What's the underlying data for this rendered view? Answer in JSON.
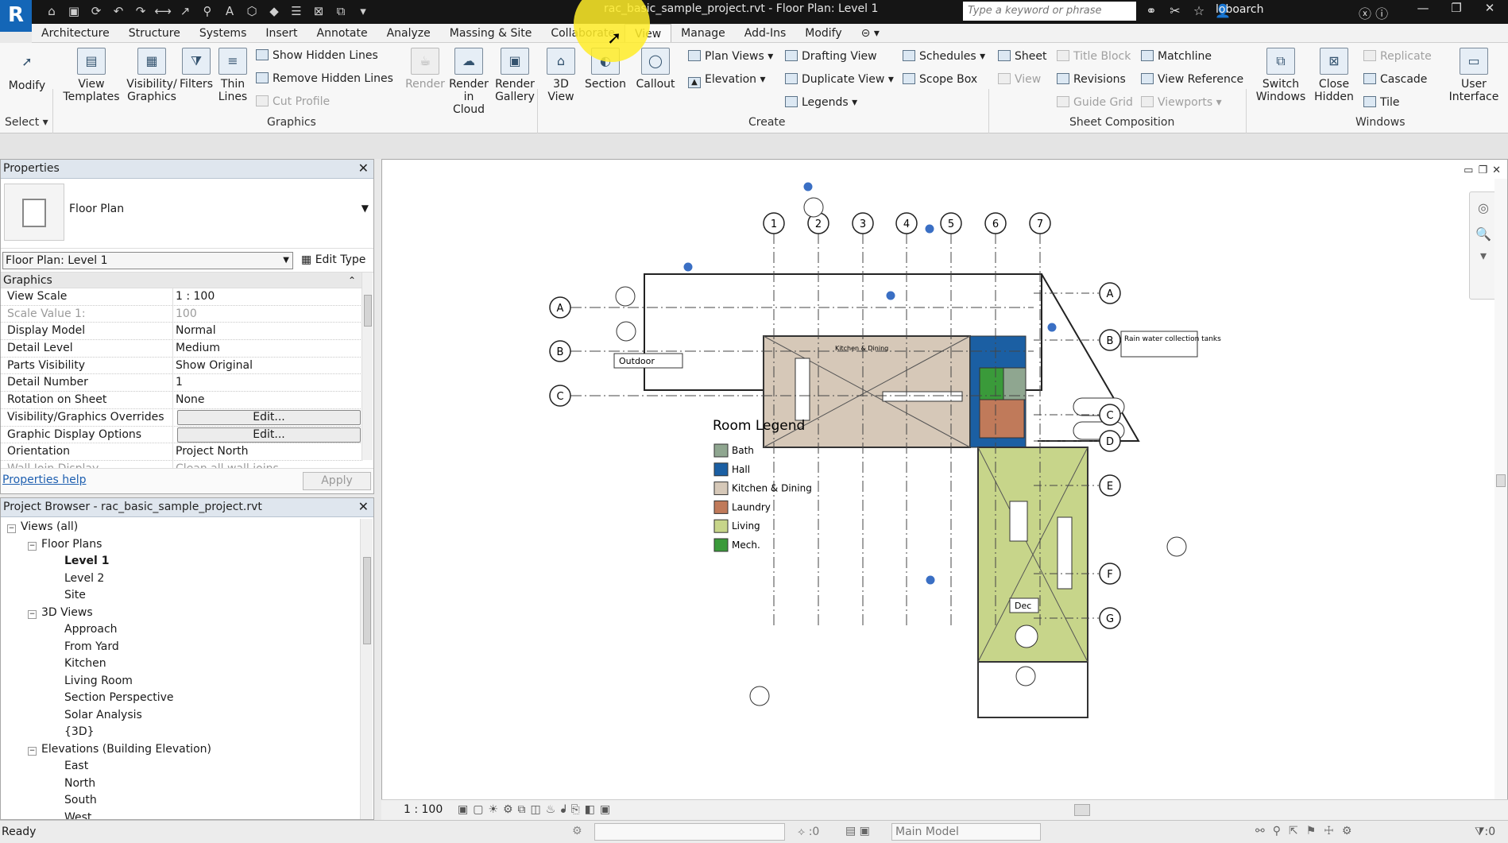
{
  "app": {
    "logo": "R",
    "title": "rac_basic_sample_project.rvt - Floor Plan: Level 1",
    "search_placeholder": "Type a keyword or phrase",
    "user": "loboarch",
    "accent": "#1466b7"
  },
  "menu": {
    "tabs": [
      "Architecture",
      "Structure",
      "Systems",
      "Insert",
      "Annotate",
      "Analyze",
      "Massing & Site",
      "Collaborate",
      "View",
      "Manage",
      "Add-Ins",
      "Modify"
    ],
    "active": "View"
  },
  "ribbon": {
    "select": {
      "modify": "Modify",
      "select_label": "Select"
    },
    "graphics": {
      "view_templates": "View Templates",
      "visibility": "Visibility/ Graphics",
      "filters": "Filters",
      "thin_lines": "Thin Lines",
      "show_hidden": "Show Hidden Lines",
      "remove_hidden": "Remove Hidden Lines",
      "cut_profile": "Cut Profile",
      "render": "Render",
      "render_cloud": "Render in Cloud",
      "render_gallery": "Render Gallery",
      "panel": "Graphics"
    },
    "create": {
      "view3d": "3D View",
      "section": "Section",
      "callout": "Callout",
      "plan_views": "Plan Views",
      "elevation": "Elevation",
      "drafting": "Drafting View",
      "duplicate": "Duplicate View",
      "legends": "Legends",
      "schedules": "Schedules",
      "scope_box": "Scope Box",
      "panel": "Create"
    },
    "sheet": {
      "sheet": "Sheet",
      "view": "View",
      "title_block": "Title Block",
      "revisions": "Revisions",
      "guide_grid": "Guide Grid",
      "matchline": "Matchline",
      "view_reference": "View Reference",
      "viewports": "Viewports",
      "panel": "Sheet Composition"
    },
    "windows": {
      "switch": "Switch Windows",
      "close_hidden": "Close Hidden",
      "replicate": "Replicate",
      "cascade": "Cascade",
      "tile": "Tile",
      "user_interface": "User Interface",
      "panel": "Windows"
    }
  },
  "properties": {
    "title": "Properties",
    "type_name": "Floor Plan",
    "instance": "Floor Plan: Level 1",
    "edit_type": "Edit Type",
    "group": "Graphics",
    "rows": [
      {
        "k": "View Scale",
        "v": "1 : 100",
        "dim": false,
        "btn": false
      },
      {
        "k": "Scale Value    1:",
        "v": "100",
        "dim": true,
        "btn": false
      },
      {
        "k": "Display Model",
        "v": "Normal",
        "dim": false,
        "btn": false
      },
      {
        "k": "Detail Level",
        "v": "Medium",
        "dim": false,
        "btn": false
      },
      {
        "k": "Parts Visibility",
        "v": "Show Original",
        "dim": false,
        "btn": false
      },
      {
        "k": "Detail Number",
        "v": "1",
        "dim": false,
        "btn": false
      },
      {
        "k": "Rotation on Sheet",
        "v": "None",
        "dim": false,
        "btn": false
      },
      {
        "k": "Visibility/Graphics Overrides",
        "v": "Edit...",
        "dim": false,
        "btn": true
      },
      {
        "k": "Graphic Display Options",
        "v": "Edit...",
        "dim": false,
        "btn": true
      },
      {
        "k": "Orientation",
        "v": "Project North",
        "dim": false,
        "btn": false
      },
      {
        "k": "Wall Join Display",
        "v": "Clean all wall joins",
        "dim": true,
        "btn": false
      }
    ],
    "help": "Properties help",
    "apply": "Apply"
  },
  "browser": {
    "title": "Project Browser - rac_basic_sample_project.rvt",
    "nodes": [
      {
        "label": "Views (all)",
        "level": 0,
        "tog": "−",
        "bold": false
      },
      {
        "label": "Floor Plans",
        "level": 1,
        "tog": "−",
        "bold": false
      },
      {
        "label": "Level 1",
        "level": 2,
        "tog": "",
        "bold": true
      },
      {
        "label": "Level 2",
        "level": 2,
        "tog": "",
        "bold": false
      },
      {
        "label": "Site",
        "level": 2,
        "tog": "",
        "bold": false
      },
      {
        "label": "3D Views",
        "level": 1,
        "tog": "−",
        "bold": false
      },
      {
        "label": "Approach",
        "level": 2,
        "tog": "",
        "bold": false
      },
      {
        "label": "From Yard",
        "level": 2,
        "tog": "",
        "bold": false
      },
      {
        "label": "Kitchen",
        "level": 2,
        "tog": "",
        "bold": false
      },
      {
        "label": "Living Room",
        "level": 2,
        "tog": "",
        "bold": false
      },
      {
        "label": "Section Perspective",
        "level": 2,
        "tog": "",
        "bold": false
      },
      {
        "label": "Solar Analysis",
        "level": 2,
        "tog": "",
        "bold": false
      },
      {
        "label": "{3D}",
        "level": 2,
        "tog": "",
        "bold": false
      },
      {
        "label": "Elevations (Building Elevation)",
        "level": 1,
        "tog": "−",
        "bold": false
      },
      {
        "label": "East",
        "level": 2,
        "tog": "",
        "bold": false
      },
      {
        "label": "North",
        "level": 2,
        "tog": "",
        "bold": false
      },
      {
        "label": "South",
        "level": 2,
        "tog": "",
        "bold": false
      },
      {
        "label": "West",
        "level": 2,
        "tog": "",
        "bold": false
      }
    ]
  },
  "drawing": {
    "grid_cols": [
      "1",
      "2",
      "3",
      "4",
      "5",
      "6",
      "7"
    ],
    "grid_rows_left": [
      "A",
      "B",
      "C"
    ],
    "grid_rows_right": [
      "A",
      "B",
      "C",
      "D",
      "E",
      "F",
      "G"
    ],
    "legend_title": "Room Legend",
    "legend": [
      {
        "name": "Bath",
        "color": "#8fa690"
      },
      {
        "name": "Hall",
        "color": "#1b5fa3"
      },
      {
        "name": "Kitchen & Dining",
        "color": "#d6c8b8"
      },
      {
        "name": "Laundry",
        "color": "#c07a5a"
      },
      {
        "name": "Living",
        "color": "#c7d58a"
      },
      {
        "name": "Mech.",
        "color": "#3a9a3a"
      }
    ],
    "labels": {
      "outdoor": "Outdoor",
      "deck": "Dec",
      "rain": "Rain water collection tanks",
      "kitchen": "Kitchen & Dining"
    }
  },
  "viewbar": {
    "scale": "1 : 100"
  },
  "status": {
    "ready": "Ready",
    "zero": ":0",
    "model": "Main Model",
    "filter": ":0"
  }
}
